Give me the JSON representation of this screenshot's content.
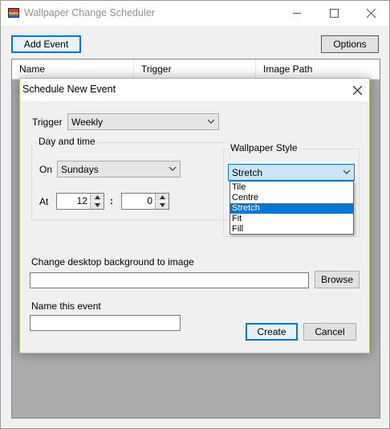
{
  "main_window": {
    "title": "Wallpaper Change Scheduler",
    "add_event_label": "Add Event",
    "options_label": "Options",
    "columns": [
      "Name",
      "Trigger",
      "Image Path"
    ]
  },
  "dialog": {
    "title": "Schedule New Event",
    "trigger_label": "Trigger",
    "trigger_value": "Weekly",
    "day_time_group": "Day and time",
    "on_label": "On",
    "on_value": "Sundays",
    "at_label": "At",
    "hour_value": "12",
    "separator": ":",
    "minute_value": "0",
    "style_group": "Wallpaper Style",
    "style_value": "Stretch",
    "style_options": [
      "Tile",
      "Centre",
      "Stretch",
      "Fit",
      "Fill"
    ],
    "style_selected_index": 2,
    "image_label": "Change desktop background to image",
    "image_value": "",
    "browse_label": "Browse",
    "name_label": "Name this event",
    "name_value": "",
    "create_label": "Create",
    "cancel_label": "Cancel"
  },
  "colors": {
    "accent": "#0078d7",
    "dialog_border": "#9fce57",
    "list_background": "#ababab",
    "window_background": "#f0f0f0"
  }
}
